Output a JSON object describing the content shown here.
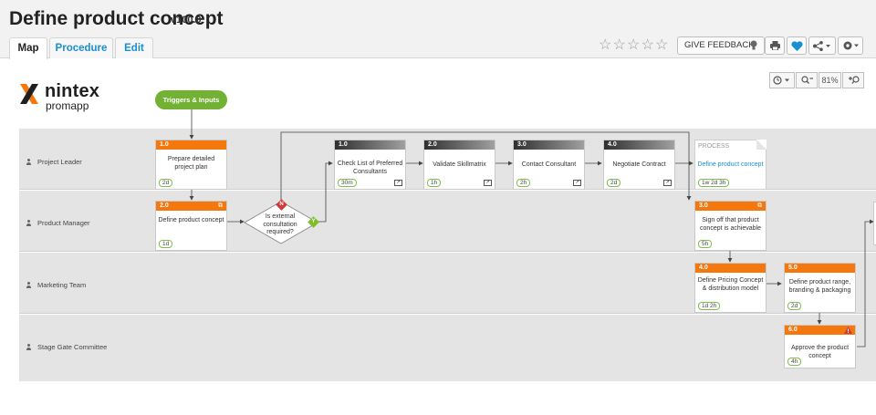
{
  "header": {
    "title": "Define product concept",
    "version": "v100.0",
    "tabs": [
      {
        "label": "Map",
        "active": true
      },
      {
        "label": "Procedure",
        "active": false
      },
      {
        "label": "Edit",
        "active": false
      }
    ],
    "rating": {
      "stars": 5,
      "filled": 0
    },
    "feedback_label": "GIVE FEEDBACK",
    "zoom_level": "81%"
  },
  "logo": {
    "brand": "nintex",
    "product": "promapp"
  },
  "trigger": {
    "label": "Triggers & Inputs"
  },
  "lanes": [
    {
      "label": "Project Leader"
    },
    {
      "label": "Product Manager"
    },
    {
      "label": "Marketing Team"
    },
    {
      "label": "Stage Gate Committee"
    }
  ],
  "activities": [
    {
      "id": "a1",
      "num": "1.0",
      "text": "Prepare detailed project plan",
      "duration": "2d"
    },
    {
      "id": "a2",
      "num": "2.0",
      "text": "Define product concept",
      "duration": "1d"
    },
    {
      "id": "c1",
      "num": "1.0",
      "text": "Check List of Preferred Consultants",
      "duration": "30m"
    },
    {
      "id": "c2",
      "num": "2.0",
      "text": "Validate Skillmatrix",
      "duration": "1h"
    },
    {
      "id": "c3",
      "num": "3.0",
      "text": "Contact Consultant",
      "duration": "2h"
    },
    {
      "id": "c4",
      "num": "4.0",
      "text": "Negotiate Contract",
      "duration": "2d"
    },
    {
      "id": "a3",
      "num": "3.0",
      "text": "Sign off that product concept is achievable",
      "duration": "5h"
    },
    {
      "id": "a4",
      "num": "4.0",
      "text": "Define Pricing Concept & distribution model",
      "duration": "1d 2h"
    },
    {
      "id": "a5",
      "num": "5.0",
      "text": "Define product range, branding & packaging",
      "duration": "2d"
    },
    {
      "id": "a6",
      "num": "6.0",
      "text": "Approve the product concept",
      "duration": "4h"
    }
  ],
  "process_link": {
    "label": "PROCESS",
    "text": "Define product concept",
    "duration": "1w 2d 3h"
  },
  "decision": {
    "text": "Is external consultation required?",
    "no": "N",
    "yes": "Y"
  },
  "colors": {
    "accent": "#1a8fd0",
    "activity": "#f5780e",
    "trigger": "#72b133",
    "lane": "#e4e4e4"
  }
}
